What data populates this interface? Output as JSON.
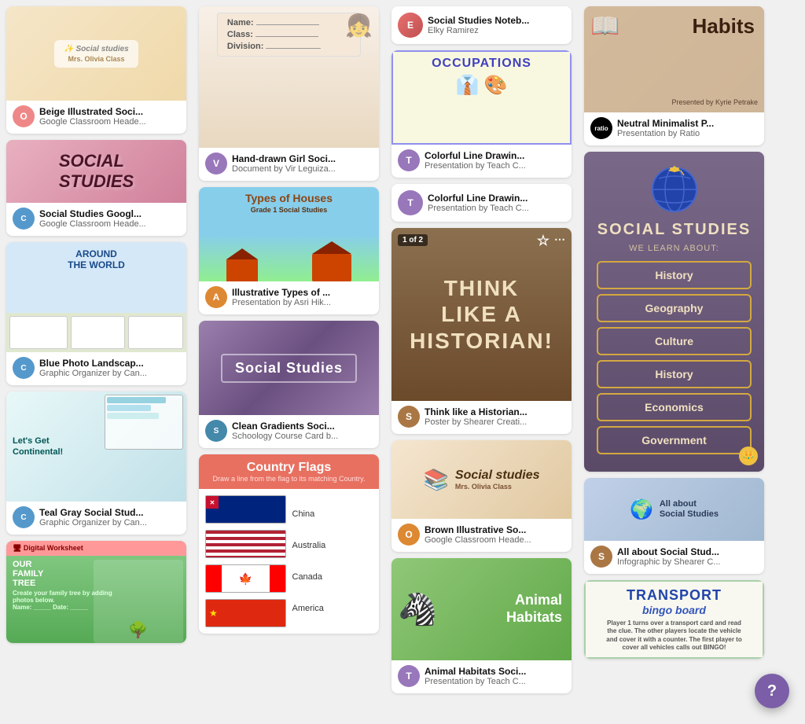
{
  "col1": {
    "cards": [
      {
        "id": "beige-soci",
        "title": "Beige Illustrated Soci...",
        "subtitle": "Google Classroom Heade...",
        "avatar_letter": "O",
        "avatar_color": "av-pink"
      },
      {
        "id": "social-studies-banner",
        "title": "Social Studies Googl...",
        "subtitle": "Google Classroom Heade...",
        "avatar_letter": "C",
        "avatar_color": "av-blue"
      },
      {
        "id": "around-world",
        "title": "Blue Photo Landscap...",
        "subtitle": "Graphic Organizer by Can...",
        "avatar_letter": "C",
        "avatar_color": "av-blue"
      },
      {
        "id": "lets-get",
        "title": "Teal Gray Social Stud...",
        "subtitle": "Graphic Organizer by Can...",
        "avatar_letter": "C",
        "avatar_color": "av-blue"
      },
      {
        "id": "family-tree",
        "title": "OuR FAMILY Tree",
        "subtitle": "",
        "avatar_letter": "",
        "avatar_color": ""
      }
    ]
  },
  "col2": {
    "cards": [
      {
        "id": "girl-soci",
        "title": "Hand-drawn Girl Soci...",
        "subtitle": "Document by Vir Leguiza...",
        "avatar_letter": "V",
        "avatar_color": "av-purple"
      },
      {
        "id": "types-houses",
        "title": "Illustrative Types of ...",
        "subtitle": "Presentation by Asri Hik...",
        "avatar_letter": "A",
        "avatar_color": "av-orange"
      },
      {
        "id": "clean-gradients",
        "title": "Clean Gradients Soci...",
        "subtitle": "Schoology Course Card b...",
        "avatar_letter": "S",
        "avatar_color": "av-teal"
      },
      {
        "id": "country-flags",
        "title": "Country Flags",
        "subtitle": "",
        "avatar_letter": "",
        "avatar_color": ""
      }
    ]
  },
  "col3": {
    "cards": [
      {
        "id": "noteb",
        "title": "Social Studies Noteb...",
        "subtitle": "Elky Ramirez",
        "avatar_letter": "E",
        "avatar_color": "av-pink"
      },
      {
        "id": "occupations",
        "title": "Colorful Line Drawin...",
        "subtitle": "Presentation by Teach C...",
        "avatar_letter": "T",
        "avatar_color": "av-purple"
      },
      {
        "id": "historian",
        "title": "Think like a Historian...",
        "subtitle": "Poster by Shearer Creati...",
        "avatar_letter": "S",
        "avatar_color": "av-brown"
      },
      {
        "id": "brown-so",
        "title": "Brown Illustrative So...",
        "subtitle": "Google Classroom Heade...",
        "avatar_letter": "O",
        "avatar_color": "av-orange"
      },
      {
        "id": "animal-habitats",
        "title": "Animal Habitats Soci...",
        "subtitle": "Presentation by Teach C...",
        "avatar_letter": "T",
        "avatar_color": "av-purple"
      }
    ]
  },
  "col4": {
    "cards": [
      {
        "id": "habits",
        "title": "Habits Neutral Minimalist Presentation by Ratio",
        "subtitle": "Neutral Minimalist P...",
        "subtitle2": "Presentation by Ratio",
        "avatar_letter": "R",
        "avatar_color": "av-dark"
      },
      {
        "id": "social-studies-dark",
        "title": "SOCIAL STUDIES",
        "subtitle": "WE LEARN ABOUT:",
        "tags": [
          "History",
          "Geography",
          "Culture",
          "History",
          "Economics",
          "Government"
        ],
        "avatar_letter": "",
        "avatar_color": ""
      },
      {
        "id": "all-about",
        "title": "All about Social Stud...",
        "subtitle": "Infographic by Shearer C...",
        "avatar_letter": "S",
        "avatar_color": "av-brown"
      },
      {
        "id": "transport",
        "title": "TRANSPORT",
        "subtitle": "bingo board",
        "avatar_letter": "",
        "avatar_color": ""
      }
    ]
  },
  "help_button_label": "?"
}
